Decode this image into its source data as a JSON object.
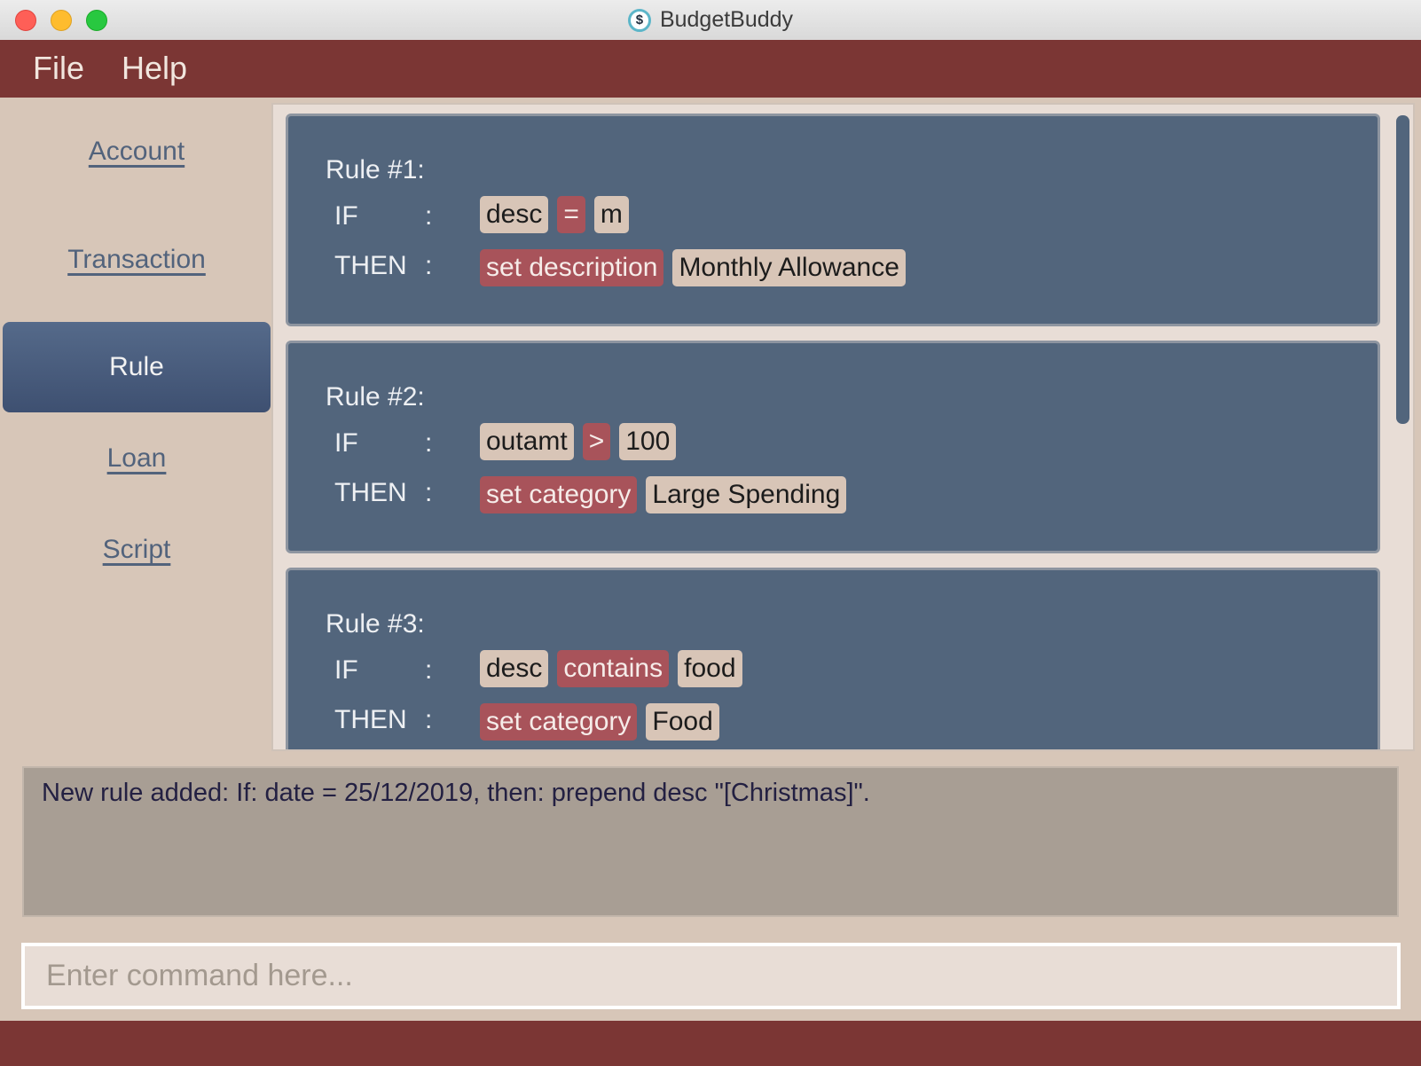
{
  "window": {
    "title": "BudgetBuddy",
    "app_icon_glyph": "$"
  },
  "menu": {
    "items": [
      "File",
      "Help"
    ]
  },
  "sidebar": {
    "items": [
      {
        "label": "Account",
        "active": false
      },
      {
        "label": "Transaction",
        "active": false
      },
      {
        "label": "Rule",
        "active": true
      },
      {
        "label": "Loan",
        "active": false
      },
      {
        "label": "Script",
        "active": false
      }
    ]
  },
  "rules": [
    {
      "title": "Rule #1:",
      "if_label": "IF",
      "then_label": "THEN",
      "separator": ":",
      "if_chips": [
        {
          "text": "desc",
          "style": "light"
        },
        {
          "text": "=",
          "style": "red"
        },
        {
          "text": "m",
          "style": "light"
        }
      ],
      "then_chips": [
        {
          "text": "set description",
          "style": "red"
        },
        {
          "text": "Monthly Allowance",
          "style": "light"
        }
      ]
    },
    {
      "title": "Rule #2:",
      "if_label": "IF",
      "then_label": "THEN",
      "separator": ":",
      "if_chips": [
        {
          "text": "outamt",
          "style": "light"
        },
        {
          "text": ">",
          "style": "red"
        },
        {
          "text": "100",
          "style": "light"
        }
      ],
      "then_chips": [
        {
          "text": "set category",
          "style": "red"
        },
        {
          "text": "Large Spending",
          "style": "light"
        }
      ]
    },
    {
      "title": "Rule #3:",
      "if_label": "IF",
      "then_label": "THEN",
      "separator": ":",
      "if_chips": [
        {
          "text": "desc",
          "style": "light"
        },
        {
          "text": "contains",
          "style": "red"
        },
        {
          "text": "food",
          "style": "light"
        }
      ],
      "then_chips": [
        {
          "text": "set category",
          "style": "red"
        },
        {
          "text": "Food",
          "style": "light"
        }
      ]
    }
  ],
  "result": {
    "text": "New rule added: If: date = 25/12/2019, then: prepend desc \"[Christmas]\"."
  },
  "command": {
    "placeholder": "Enter command here...",
    "value": ""
  },
  "colors": {
    "menubar": "#7b3634",
    "active_nav": "#4a5d7e",
    "card": "#52657c",
    "chip_red": "#a8535a",
    "chip_light": "#d8c5b7"
  }
}
